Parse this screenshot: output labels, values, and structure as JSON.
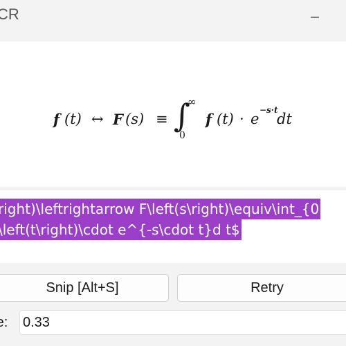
{
  "window": {
    "title": "CR",
    "minimize_icon": "minimize-icon",
    "close_icon": "close-icon"
  },
  "preview": {
    "formula_parts": {
      "f1": "f",
      "t1": "(t)",
      "arrow": "↔",
      "F": "F",
      "s": "(s)",
      "equiv": "≡",
      "integral": "∫",
      "upper": "∞",
      "lower": "0",
      "f2": "f",
      "t2": "(t)",
      "cdot": "·",
      "e": "e",
      "exp": "−s·t",
      "dt": "dt"
    }
  },
  "latex": {
    "line1": "right)\\leftrightarrow F\\left(s\\right)\\equiv\\int_{0",
    "line2": "\\left(t\\right)\\cdot e^{-s\\cdot t}d t$"
  },
  "buttons": {
    "snip_label": "Snip [Alt+S]",
    "retry_label": "Retry"
  },
  "score": {
    "label": "re:",
    "value": "0.33"
  },
  "colors": {
    "selection": "#9b3fc8",
    "background": "#f3f3f3"
  }
}
